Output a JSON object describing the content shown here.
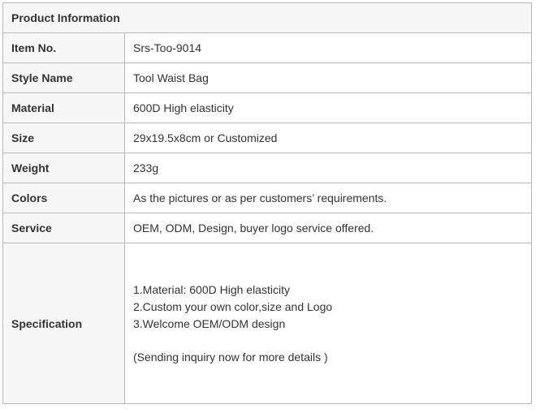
{
  "table": {
    "header": "Product Information",
    "rows": [
      {
        "label": "Item No.",
        "value": "Srs-Too-9014"
      },
      {
        "label": "Style Name",
        "value": "Tool Waist Bag"
      },
      {
        "label": "Material",
        "value": "600D High elasticity"
      },
      {
        "label": "Size",
        "value": "29x19.5x8cm or Customized"
      },
      {
        "label": "Weight",
        "value": "233g"
      },
      {
        "label": "Colors",
        "value": "As the pictures or as per customers’ requirements."
      },
      {
        "label": "Service",
        "value": "OEM, ODM, Design, buyer logo service offered."
      }
    ],
    "specification": {
      "label": "Specification",
      "lines": [
        "1.Material: 600D High elasticity",
        "2.Custom your own color,size and  Logo",
        "3.Welcome OEM/ODM design"
      ],
      "note": "(Sending inquiry now for more details )"
    }
  }
}
